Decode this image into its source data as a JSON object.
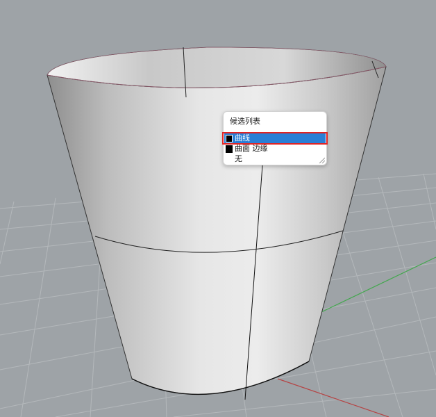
{
  "popup": {
    "title": "候选列表",
    "items": [
      {
        "label": "曲线",
        "swatch_color": "#000000",
        "selected": true
      },
      {
        "label": "曲面 边缘",
        "swatch_color": "#000000",
        "selected": false
      },
      {
        "label": "无",
        "swatch_color": "",
        "selected": false
      }
    ]
  },
  "colors": {
    "selection": "#2a7fd6",
    "highlight_box": "#e02424",
    "x_axis": "#b83a3a",
    "y_axis": "#3aa845",
    "grid_background": "#9ea3a7"
  }
}
